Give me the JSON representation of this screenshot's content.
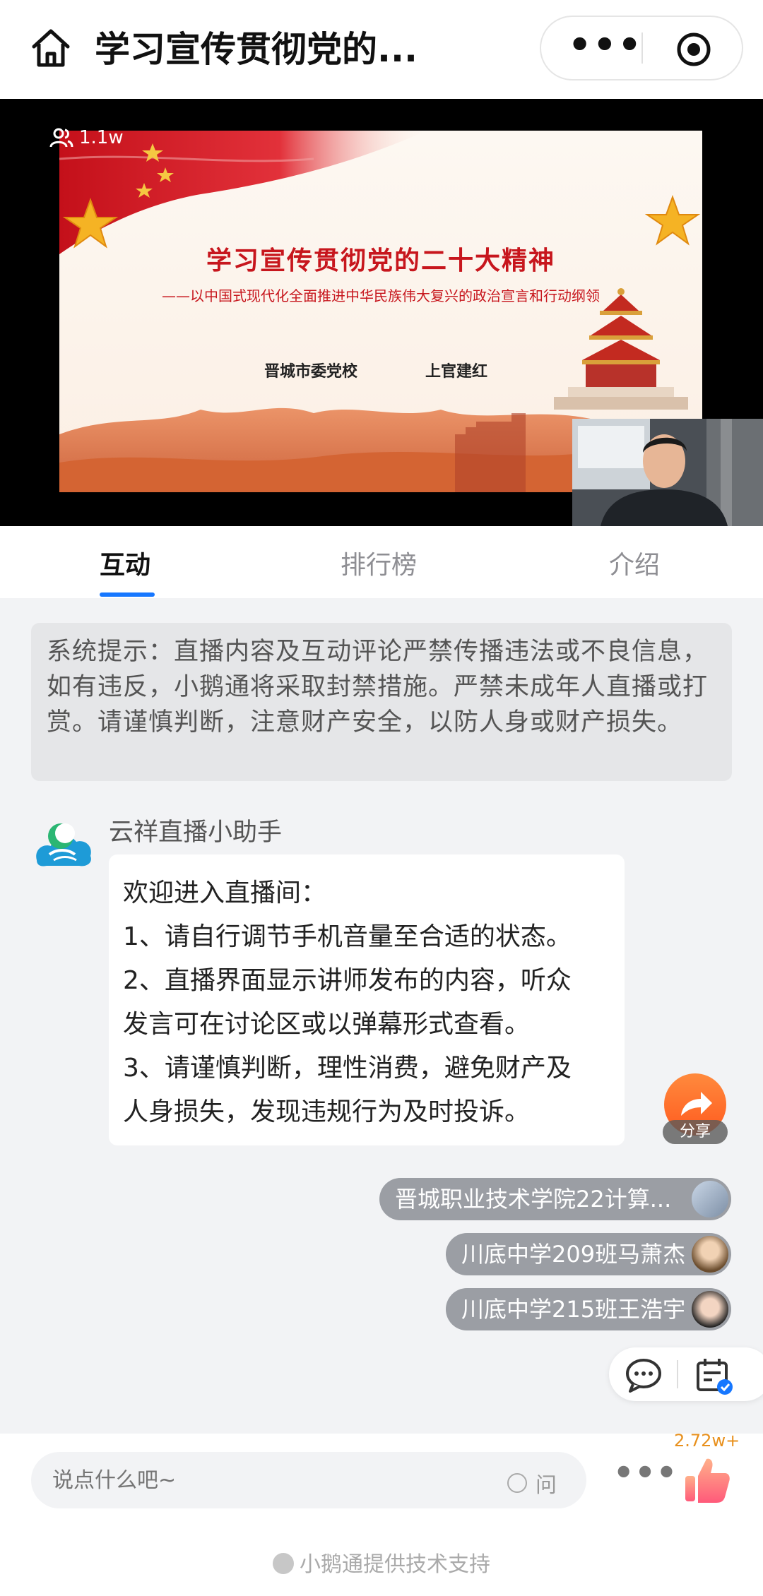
{
  "header": {
    "title": "学习宣传贯彻党的...",
    "home_icon": "home-icon",
    "more_icon": "more-dots-icon",
    "close_icon": "target-icon"
  },
  "video": {
    "viewer_count": "1.1w",
    "slide_title": "学习宣传贯彻党的二十大精神",
    "slide_subtitle": "——以中国式现代化全面推进中华民族伟大复兴的政治宣言和行动纲领",
    "slide_author_org": "晋城市委党校",
    "slide_author_name": "上官建红"
  },
  "tabs": [
    {
      "label": "互动",
      "active": true
    },
    {
      "label": "排行榜",
      "active": false
    },
    {
      "label": "介绍",
      "active": false
    }
  ],
  "notice": "系统提示：直播内容及互动评论严禁传播违法或不良信息，如有违反，小鹅通将采取封禁措施。严禁未成年人直播或打赏。请谨慎判断，注意财产安全，以防人身或财产损失。",
  "assistant": {
    "name": "云祥直播小助手",
    "lines": [
      "欢迎进入直播间：",
      "1、请自行调节手机音量至合适的状态。",
      "2、直播界面显示讲师发布的内容，听众",
      "发言可在讨论区或以弹幕形式查看。",
      "3、请谨慎判断，理性消费，避免财产及",
      "人身损失，发现违规行为及时投诉。"
    ]
  },
  "share_label": "分享",
  "joins": [
    "晋城职业技术学院22计算...",
    "川底中学209班马萧杰",
    "川底中学215班王浩宇"
  ],
  "bottom": {
    "placeholder": "说点什么吧~",
    "ask_label": "问",
    "like_count": "2.72w+",
    "powered_by": "小鹅通提供技术支持"
  },
  "colors": {
    "accent": "#1677ff",
    "slide_red": "#c7161d",
    "like_orange": "#e8901c"
  }
}
